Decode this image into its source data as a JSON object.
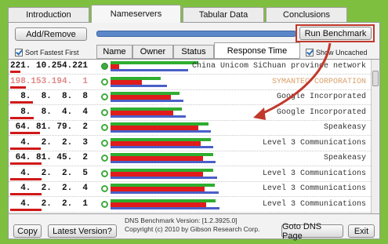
{
  "tabs": [
    "Introduction",
    "Nameservers",
    "Tabular Data",
    "Conclusions"
  ],
  "toolbar": {
    "add_remove": "Add/Remove",
    "run_benchmark": "Run Benchmark",
    "sort_label": "Sort Fastest First",
    "show_uncached": "Show Uncached"
  },
  "columns": [
    "Name",
    "Owner",
    "Status",
    "Response Time"
  ],
  "rows": [
    {
      "ip": "221. 10.254.221",
      "status": "solid",
      "owner": "China Unicom SiChuan province network",
      "red": 0.07,
      "green": 0.7,
      "blue": 0.62,
      "dim": false
    },
    {
      "ip": "198.153.194.  1",
      "status": "ring",
      "owner": "SYMANTEC CORPORATION",
      "red": 0.25,
      "green": 0.4,
      "blue": 0.45,
      "dim": true
    },
    {
      "ip": "  8.  8.  8.  8",
      "status": "ring",
      "owner": "Google Incorporated",
      "red": 0.48,
      "green": 0.55,
      "blue": 0.58,
      "dim": false
    },
    {
      "ip": "  8.  8.  4.  4",
      "status": "ring",
      "owner": "Google Incorporated",
      "red": 0.5,
      "green": 0.57,
      "blue": 0.6,
      "dim": false
    },
    {
      "ip": " 64. 81. 79.  2",
      "status": "ring",
      "owner": "Speakeasy",
      "red": 0.7,
      "green": 0.78,
      "blue": 0.8,
      "dim": false
    },
    {
      "ip": "  4.  2.  2.  3",
      "status": "ring",
      "owner": "Level 3 Communications",
      "red": 0.72,
      "green": 0.8,
      "blue": 0.82,
      "dim": false
    },
    {
      "ip": " 64. 81. 45.  2",
      "status": "ring",
      "owner": "Speakeasy",
      "red": 0.74,
      "green": 0.82,
      "blue": 0.84,
      "dim": false
    },
    {
      "ip": "  4.  2.  2.  5",
      "status": "ring",
      "owner": "Level 3 Communications",
      "red": 0.74,
      "green": 0.82,
      "blue": 0.85,
      "dim": false
    },
    {
      "ip": "  4.  2.  2.  4",
      "status": "ring",
      "owner": "Level 3 Communications",
      "red": 0.75,
      "green": 0.83,
      "blue": 0.86,
      "dim": false
    },
    {
      "ip": "  4.  2.  2.  1",
      "status": "ring",
      "owner": "Level 3 Communications",
      "red": 0.76,
      "green": 0.84,
      "blue": 0.87,
      "dim": false
    }
  ],
  "footer": {
    "copy": "Copy",
    "latest": "Latest Version?",
    "version_line": "DNS Benchmark Version: [1.2.3925.0]",
    "copyright_line": "Copyright (c) 2010 by Gibson Research Corp.",
    "goto": "Goto DNS Page",
    "exit": "Exit"
  },
  "colors": {
    "highlight": "#c0392b",
    "bar_red": "#e01b1b",
    "bar_green": "#2fae2f",
    "bar_blue": "#4a5fc8"
  }
}
